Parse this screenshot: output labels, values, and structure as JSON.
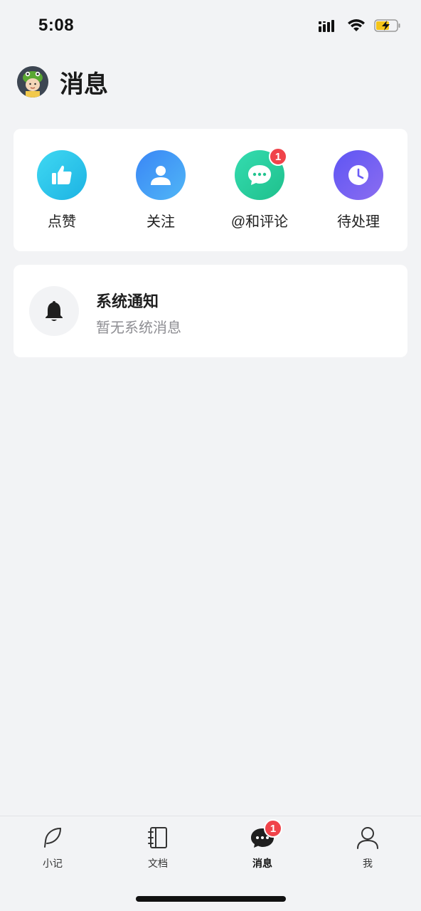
{
  "status_bar": {
    "time": "5:08",
    "icons": [
      "signal-icon",
      "wifi-icon",
      "battery-charging-icon"
    ],
    "battery_color": "#f5c518"
  },
  "header": {
    "title": "消息",
    "avatar_icon": "avatar"
  },
  "entries": [
    {
      "label": "点赞",
      "icon": "thumbs-up-icon",
      "gradient": [
        "#39d3f0",
        "#1fb8e0"
      ],
      "badge": ""
    },
    {
      "label": "关注",
      "icon": "user-icon",
      "gradient": [
        "#3a8cf7",
        "#4fb3f5"
      ],
      "badge": ""
    },
    {
      "label": "@和评论",
      "icon": "chat-bubble-icon",
      "gradient": [
        "#2ed6a8",
        "#23c48f"
      ],
      "badge": "1"
    },
    {
      "label": "待处理",
      "icon": "clock-icon",
      "gradient": [
        "#6b5cf6",
        "#8a6af0"
      ],
      "badge": ""
    }
  ],
  "system_notice": {
    "title": "系统通知",
    "subtitle": "暂无系统消息",
    "icon": "bell-icon"
  },
  "tab_bar": {
    "tabs": [
      {
        "label": "小记",
        "icon": "feather-icon",
        "active": false,
        "badge": ""
      },
      {
        "label": "文档",
        "icon": "notebook-icon",
        "active": false,
        "badge": ""
      },
      {
        "label": "消息",
        "icon": "message-icon",
        "active": true,
        "badge": "1"
      },
      {
        "label": "我",
        "icon": "person-icon",
        "active": false,
        "badge": ""
      }
    ]
  },
  "colors": {
    "background": "#f2f3f5",
    "card": "#ffffff",
    "badge": "#f0434a",
    "secondary_text": "#8e8e93"
  }
}
